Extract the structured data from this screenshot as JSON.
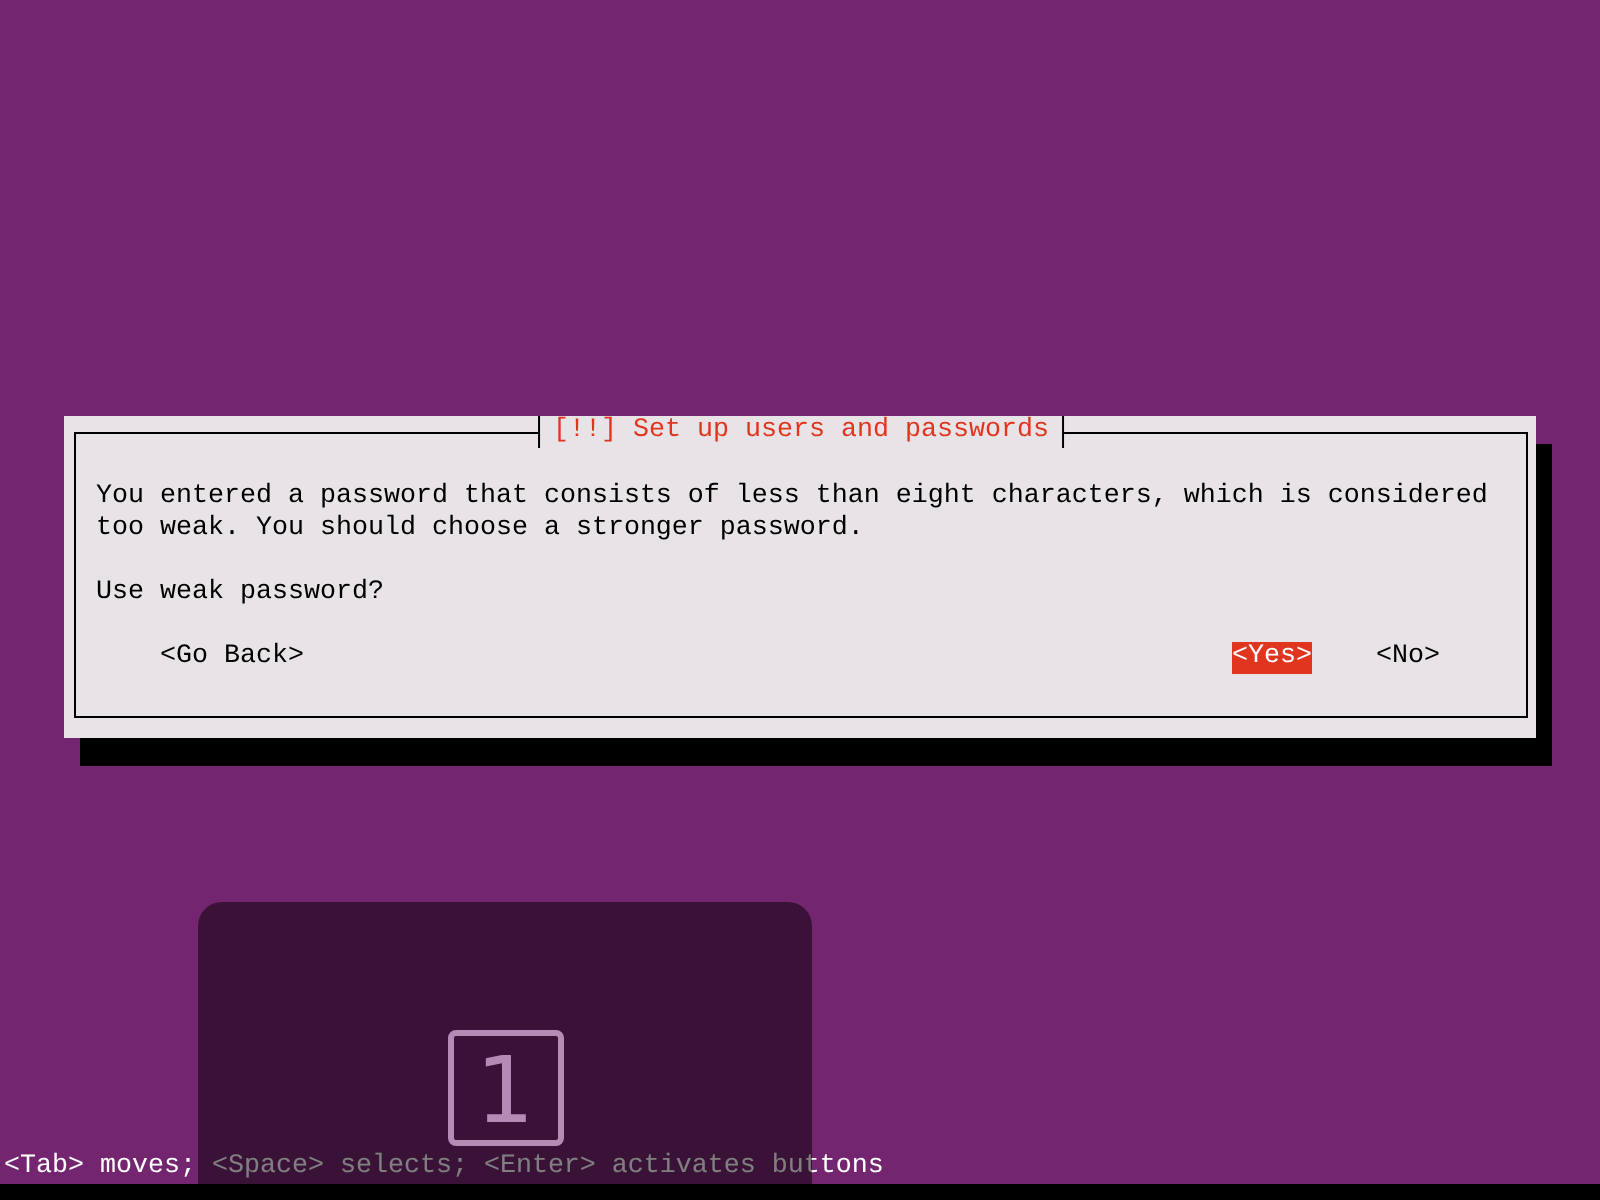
{
  "dialog": {
    "title": "[!!] Set up users and passwords",
    "message": "You entered a password that consists of less than eight characters, which is considered too weak. You should choose a stronger password.",
    "question": "Use weak password?",
    "buttons": [
      {
        "label": "<Go Back>",
        "selected": false
      },
      {
        "label": "<Yes>",
        "selected": true
      },
      {
        "label": "<No>",
        "selected": false
      }
    ]
  },
  "help_line": "<Tab> moves; <Space> selects; <Enter> activates buttons",
  "overlay": {
    "key": "1"
  }
}
